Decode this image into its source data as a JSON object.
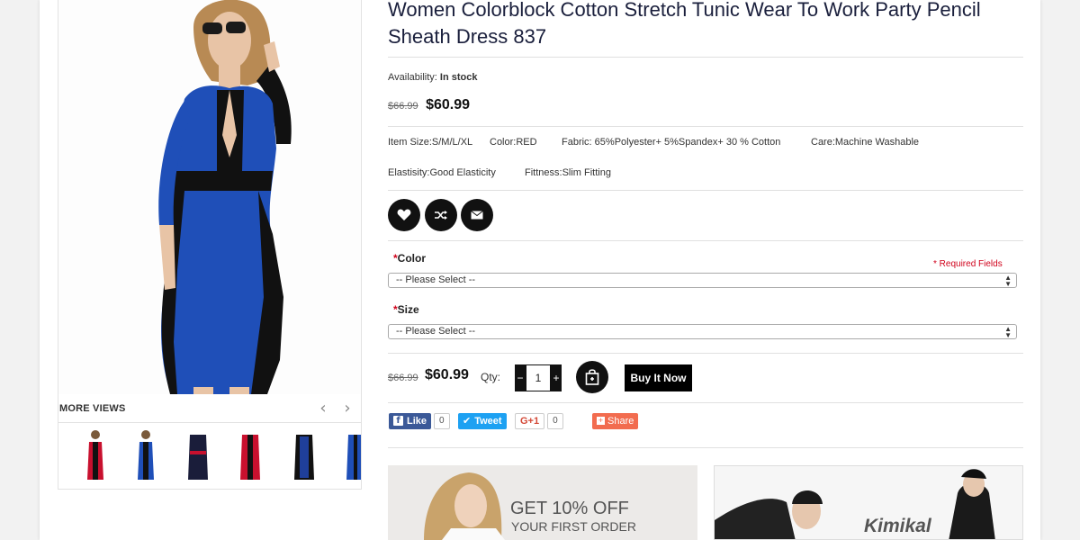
{
  "product": {
    "title": "Women Colorblock Cotton Stretch Tunic Wear To Work Party Pencil Sheath Dress 837",
    "availability_label": "Availability:",
    "availability_value": "In stock",
    "old_price": "$66.99",
    "price": "$60.99"
  },
  "attributes": {
    "item_size": "Item Size:S/M/L/XL",
    "color": "Color:RED",
    "fabric": "Fabric: 65%Polyester+ 5%Spandex+ 30 % Cotton",
    "care": "Care:Machine Washable",
    "elasticity": "Elastisity:Good Elasticity",
    "fitness": "Fittness:Slim Fitting"
  },
  "actions": {
    "icons": [
      "heart-icon",
      "shuffle-icon",
      "envelope-icon"
    ]
  },
  "options": {
    "color_label": "Color",
    "size_label": "Size",
    "asterisk": "*",
    "required_fields": "* Required Fields",
    "color_select": "-- Please Select --",
    "size_select": "-- Please Select --"
  },
  "purchase": {
    "old_price": "$66.99",
    "price": "$60.99",
    "qty_label": "Qty:",
    "qty_value": "1",
    "minus": "−",
    "plus": "+",
    "buy_now": "Buy It Now"
  },
  "social": {
    "like": "Like",
    "like_count": "0",
    "tweet": "Tweet",
    "gplus": "G+1",
    "gplus_count": "0",
    "share": "Share"
  },
  "gallery": {
    "more_views": "MORE VIEWS",
    "prev": "‹",
    "next": "›",
    "thumbnails": [
      "red",
      "blue",
      "navy",
      "red",
      "navy",
      "blue"
    ]
  },
  "banners": {
    "promo_line1": "GET 10% OFF",
    "promo_line2": "YOUR FIRST ORDER",
    "brand": "Kimikal"
  },
  "colors": {
    "dress_blue": "#1f4fb8",
    "dress_black": "#111111",
    "dress_red": "#c8102e",
    "facebook": "#3b5998",
    "twitter": "#1da1f2",
    "share": "#f26c4f",
    "required": "#d0021b"
  }
}
